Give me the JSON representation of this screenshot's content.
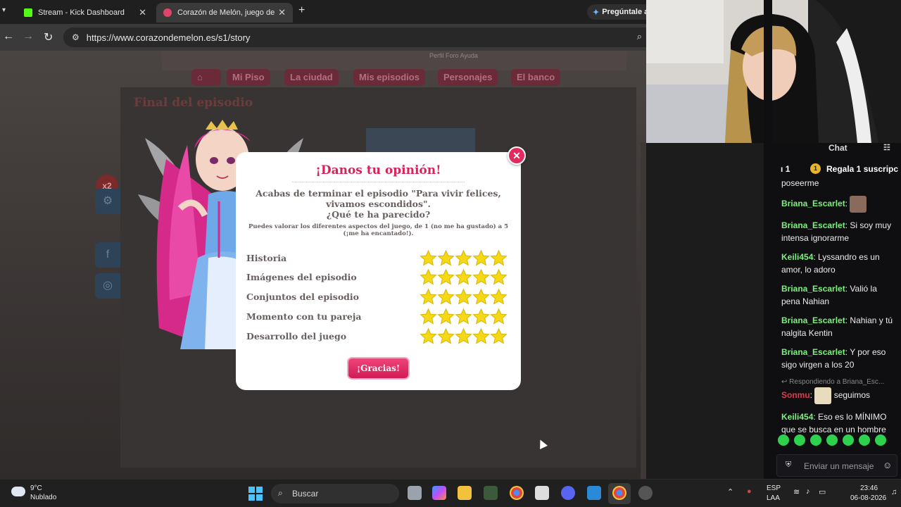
{
  "browser": {
    "tabs": [
      {
        "title": "Stream - Kick Dashboard",
        "favicon_color": "#53fc18"
      },
      {
        "title": "Corazón de Melón, juego de ar",
        "favicon_color": "#e2436b"
      }
    ],
    "gemini_label": "Pregúntale a",
    "url": "https://www.corazondemelon.es/s1/story"
  },
  "game": {
    "nav_items": [
      "Mi Piso",
      "La ciudad",
      "Mis episodios",
      "Personajes",
      "El banco"
    ],
    "mini_links": "Perfil   Foro   Ayuda",
    "episode_title": "Final del episodio",
    "bonus_badge": "x2"
  },
  "modal": {
    "title": "¡Danos tu opinión!",
    "message": "Acabas de terminar el episodio \"Para vivir felices, vivamos escondidos\".",
    "question": "¿Qué te ha parecido?",
    "hint": "Puedes valorar los diferentes aspectos del juego, de 1 (no me ha gustado) a 5 (¡me ha encantado!).",
    "ratings": [
      {
        "label": "Historia",
        "stars": 5
      },
      {
        "label": "Imágenes del episodio",
        "stars": 5
      },
      {
        "label": "Conjuntos del episodio",
        "stars": 5
      },
      {
        "label": "Momento con tu pareja",
        "stars": 5
      },
      {
        "label": "Desarrollo del juego",
        "stars": 5
      }
    ],
    "submit_label": "¡Gracias!",
    "close_icon": "close-icon",
    "accent_color": "#d6245b"
  },
  "chat": {
    "title": "Chat",
    "viewer_count": "1",
    "gift_label": "Regala 1 suscripc",
    "messages": [
      {
        "user": "",
        "text": "poseerme"
      },
      {
        "user": "Briana_Escarlet",
        "text": "",
        "emote": true
      },
      {
        "user": "Briana_Escarlet",
        "text": "Si soy muy intensa ignorarme"
      },
      {
        "user": "Keili454",
        "text": "Lyssandro es un amor, lo adoro"
      },
      {
        "user": "Briana_Escarlet",
        "text": "Valió la pena Nahian"
      },
      {
        "user": "Briana_Escarlet",
        "text": "Nahian y tú nalgita Kentin"
      },
      {
        "user": "Briana_Escarlet",
        "text": "Y por eso sigo virgen a los 20"
      },
      {
        "reply_to": "Respondiendo a Briana_Esc...",
        "user": "Sonmu",
        "text": "seguimos",
        "emote": true
      },
      {
        "user": "Keili454",
        "text": "Eso es lo MÍNIMO que se busca en un hombre"
      }
    ],
    "input_placeholder": "Enviar un mensaje",
    "user_colors": {
      "Briana_Escarlet": "#7cf07c",
      "Keili454": "#7cf07c",
      "Sonmu": "#e23a4a"
    }
  },
  "taskbar": {
    "weather_temp": "9°C",
    "weather_desc": "Nublado",
    "search_label": "Buscar",
    "lang_line1": "ESP",
    "lang_line2": "LAA",
    "time": "23:46",
    "date": "06-08-2026"
  }
}
